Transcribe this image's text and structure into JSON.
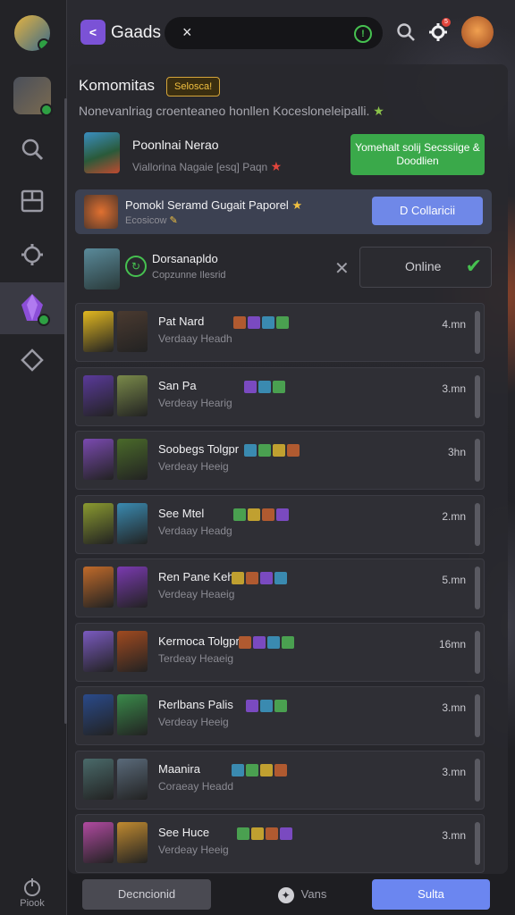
{
  "app": {
    "title": "Gaads",
    "logo_glyph": "<"
  },
  "search": {
    "clear": "×",
    "info": "!"
  },
  "header_icons": {
    "notif_count": "5"
  },
  "rail": {
    "footer_label": "Piook"
  },
  "section": {
    "title": "Komomitas",
    "tag": "Selosca!",
    "subtitle": "Nonevanlriag croenteaneo honllen Kocesloneleipalli."
  },
  "card1": {
    "name": "Poonlnai Nerao",
    "sub": "Viallorina Nagaie [esq] Paqn",
    "button": "Yomehalt solij Secssiige & Doodlien"
  },
  "card2": {
    "name": "Pomokl Seramd Gugait Paporel",
    "sub": "Ecosicow",
    "button": "D Collaricii"
  },
  "card3": {
    "name": "Dorsanapldo",
    "sub": "Copzunne Ilesrid",
    "status": "Online"
  },
  "rows": [
    {
      "name": "Pat Nard",
      "sub": "Verdaay Headh",
      "time": "4.mn",
      "chips": 4
    },
    {
      "name": "San Pa",
      "sub": "Verdeay Hearig",
      "time": "3.mn",
      "chips": 3
    },
    {
      "name": "Soobegs Tolgpr",
      "sub": "Verdeay Heeig",
      "time": "3hn",
      "chips": 4
    },
    {
      "name": "See Mtel",
      "sub": "Verdaay Headg",
      "time": "2.mn",
      "chips": 4
    },
    {
      "name": "Ren Pane Keh",
      "sub": "Verdeay Heaeig",
      "time": "5.mn",
      "chips": 4
    },
    {
      "name": "Kermoca Tolgpr",
      "sub": "Terdeay Heaeig",
      "time": "16mn",
      "chips": 4
    },
    {
      "name": "Rerlbans Palis",
      "sub": "Verdeay Heeig",
      "time": "3.mn",
      "chips": 3
    },
    {
      "name": "Maanira",
      "sub": "Coraeay Headd",
      "time": "3.mn",
      "chips": 4
    },
    {
      "name": "See Huce",
      "sub": "Verdeay Heeig",
      "time": "3.mn",
      "chips": 4
    }
  ],
  "bottom": {
    "left": "Decncionid",
    "middle": "Vans",
    "right": "Sulta"
  },
  "colors": {
    "accent_green": "#3aa94a",
    "accent_blue": "#6f88e8",
    "accent_purple": "#7b52d6",
    "tag_gold": "#f1c040"
  }
}
